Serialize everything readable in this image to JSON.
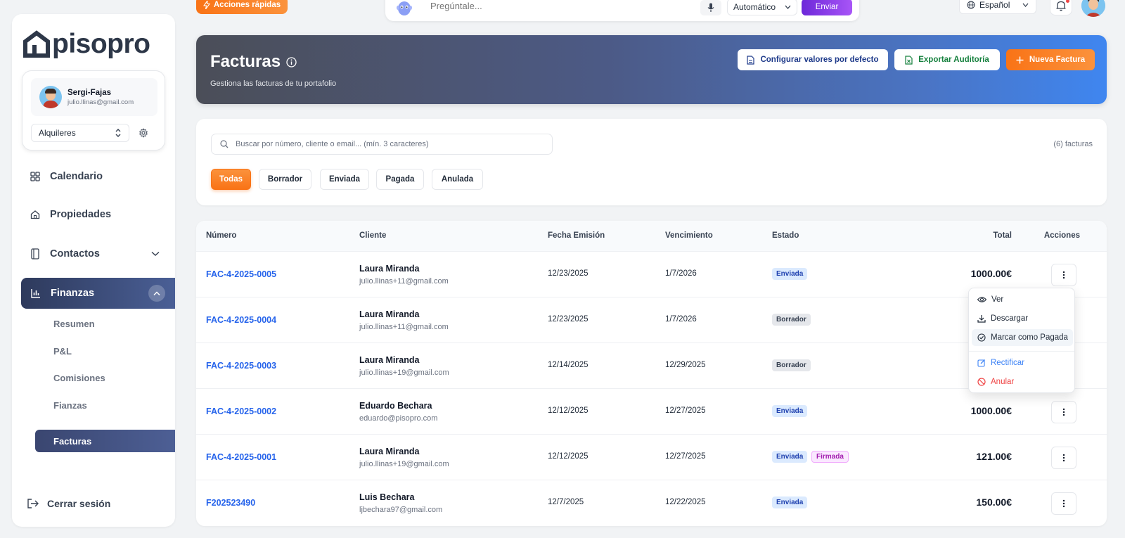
{
  "sidebar": {
    "logo": "pisopro",
    "user": {
      "name": "Sergi-Fajas",
      "email": "julio.llinas@gmail.com"
    },
    "mode_select": "Alquileres",
    "nav": [
      {
        "label": "Calendario",
        "icon": "grid-icon"
      },
      {
        "label": "Propiedades",
        "icon": "home-icon"
      },
      {
        "label": "Contactos",
        "icon": "contacts-icon"
      },
      {
        "label": "Finanzas",
        "icon": "chart-icon"
      }
    ],
    "sub_items": [
      "Resumen",
      "P&L",
      "Comisiones",
      "Fianzas",
      "Facturas"
    ],
    "logout": "Cerrar sesión"
  },
  "topbar": {
    "quick_actions": "Acciones rápidas",
    "ask_placeholder": "Pregúntale...",
    "mode": "Automático",
    "send": "Enviar",
    "language": "Español"
  },
  "hero": {
    "title": "Facturas",
    "subtitle": "Gestiona las facturas de tu portafolio",
    "btn_config": "Configurar valores por defecto",
    "btn_audit": "Exportar Auditoría",
    "btn_new": "Nueva Factura"
  },
  "filters": {
    "search_placeholder": "Buscar por número, cliente o email... (mín. 3 caracteres)",
    "count": "(6) facturas",
    "chips": [
      "Todas",
      "Borrador",
      "Enviada",
      "Pagada",
      "Anulada"
    ]
  },
  "table": {
    "headers": [
      "Número",
      "Cliente",
      "Fecha Emisión",
      "Vencimiento",
      "Estado",
      "Total",
      "Acciones"
    ],
    "rows": [
      {
        "numero": "FAC-4-2025-0005",
        "cliente": "Laura Miranda",
        "email": "julio.llinas+11@gmail.com",
        "emision": "12/23/2025",
        "vencimiento": "1/7/2026",
        "estado": [
          "Enviada"
        ],
        "total": "1000.00€"
      },
      {
        "numero": "FAC-4-2025-0004",
        "cliente": "Laura Miranda",
        "email": "julio.llinas+11@gmail.com",
        "emision": "12/23/2025",
        "vencimiento": "1/7/2026",
        "estado": [
          "Borrador"
        ],
        "total": ""
      },
      {
        "numero": "FAC-4-2025-0003",
        "cliente": "Laura Miranda",
        "email": "julio.llinas+19@gmail.com",
        "emision": "12/14/2025",
        "vencimiento": "12/29/2025",
        "estado": [
          "Borrador"
        ],
        "total": ""
      },
      {
        "numero": "FAC-4-2025-0002",
        "cliente": "Eduardo Bechara",
        "email": "eduardo@pisopro.com",
        "emision": "12/12/2025",
        "vencimiento": "12/27/2025",
        "estado": [
          "Enviada"
        ],
        "total": "1000.00€"
      },
      {
        "numero": "FAC-4-2025-0001",
        "cliente": "Laura Miranda",
        "email": "julio.llinas+19@gmail.com",
        "emision": "12/12/2025",
        "vencimiento": "12/27/2025",
        "estado": [
          "Enviada",
          "Firmada"
        ],
        "total": "121.00€"
      },
      {
        "numero": "F202523490",
        "cliente": "Luis Bechara",
        "email": "ljbechara97@gmail.com",
        "emision": "12/7/2025",
        "vencimiento": "12/22/2025",
        "estado": [
          "Enviada"
        ],
        "total": "150.00€"
      }
    ]
  },
  "menu": {
    "items": [
      "Ver",
      "Descargar",
      "Marcar como Pagada",
      "Rectificar",
      "Anular"
    ]
  },
  "colors": {
    "accent_orange": "#f97316",
    "nav_active": "#2e3a5c",
    "link_blue": "#2563eb"
  }
}
